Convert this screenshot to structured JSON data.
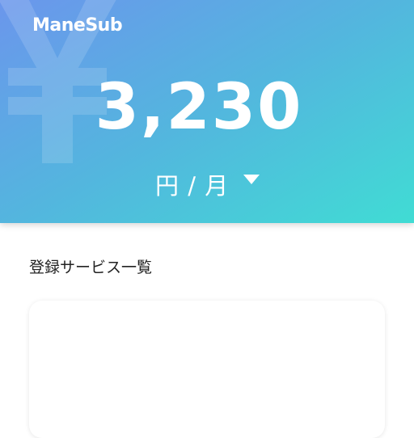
{
  "header": {
    "logo": "ManeSub",
    "background_icon": "yen-icon",
    "amount": "3,230",
    "period_label": "円 / 月",
    "caret_icon": "caret-down-icon",
    "gradient_colors": [
      "#6b96ec",
      "#53b6de",
      "#40dcd4"
    ]
  },
  "main": {
    "section_title": "登録サービス一覧"
  }
}
